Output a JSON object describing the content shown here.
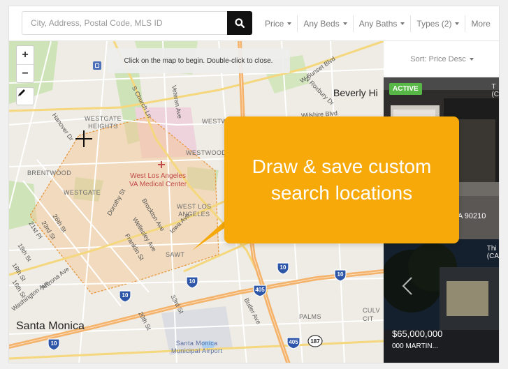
{
  "search": {
    "placeholder": "City, Address, Postal Code, MLS ID"
  },
  "filters": [
    {
      "label": "Price"
    },
    {
      "label": "Any Beds"
    },
    {
      "label": "Any Baths"
    },
    {
      "label": "Types (2)"
    },
    {
      "label": "More"
    }
  ],
  "map": {
    "hint": "Click on the map to begin. Double-click to close.",
    "zoom_in": "+",
    "zoom_out": "−",
    "labels": {
      "westgate_heights": "WESTGATE\nHEIGHTS",
      "westwood": "WESTWOOD",
      "westwood2": "WESTWOOD",
      "brentwood": "BRENTWOOD",
      "westgate": "WESTGATE",
      "va": "West Los Angeles\nVA Medical Center",
      "west_la": "WEST LOS\nANGELES",
      "sawtelle": "SAWT",
      "beverly_hills": "Beverly Hi",
      "santa_monica": "Santa Monica",
      "airport": "Santa Monica\nMunicipal Airport",
      "palms": "PALMS",
      "culver": "CULV\nCIT",
      "sunset": "W Sunset Blvd",
      "wilshire": "Wilshire Blvd",
      "church": "S Church Ln",
      "veteran": "Veteran Ave",
      "roxbury": "N Roxbury Dr",
      "hanover": "Hanover Dr",
      "dorothy": "Dorothy St",
      "brockton": "Brockton Ave",
      "wellesley": "Wellesley Ave",
      "franklin": "Franklin St",
      "iowa": "Iowa Ave",
      "st26": "26th St",
      "st23": "23rd St",
      "st21": "21st Pl",
      "st19": "19th St",
      "st18": "18th St",
      "st16": "16th St",
      "arizona": "Arizona Ave",
      "washington": "Washington Ave",
      "st33": "33rd St",
      "st20": "20th St",
      "butler": "Butler Ave"
    },
    "shields": [
      "10",
      "10",
      "10",
      "10",
      "405",
      "10",
      "405",
      "187"
    ]
  },
  "callout": {
    "text": "Draw & save custom search locations"
  },
  "panel": {
    "sort_label": "Sort: Price Desc",
    "cards": [
      {
        "badge": "ACTIVE",
        "side": "T\n(C",
        "address": "CA 90210"
      },
      {
        "badge": "",
        "side": "Thi\n(CA",
        "price": "$65,000,000",
        "price_sub": "000 MARTIN..."
      }
    ]
  },
  "colors": {
    "accent": "#f6a908",
    "badge": "#58b847",
    "freeway": "#f4b26a",
    "park": "#c8dfae",
    "polygon": "#f3c896"
  }
}
